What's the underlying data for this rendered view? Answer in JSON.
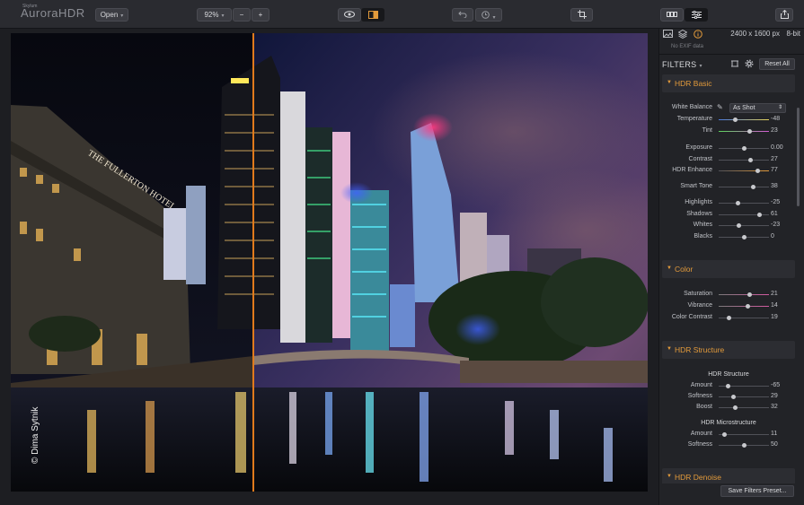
{
  "app": {
    "logo_small": "Skylum",
    "logo": "AuroraHDR"
  },
  "toolbar": {
    "open_label": "Open",
    "zoom_value": "92%",
    "zoom_out_label": "−",
    "zoom_in_label": "+"
  },
  "photo": {
    "credit": "© Dima Sytnik"
  },
  "info": {
    "size": "2400 x 1600 px",
    "bitdepth": "8-bit",
    "exif": "No EXIF data"
  },
  "filters": {
    "title": "FILTERS",
    "reset_label": "Reset All",
    "save_preset_label": "Save Filters Preset..."
  },
  "sections": {
    "basic": {
      "title": "HDR Basic",
      "white_balance_label": "White Balance",
      "white_balance_value": "As Shot",
      "rows": [
        {
          "label": "Temperature",
          "value": "-48",
          "pos": 0.33,
          "track": "wb"
        },
        {
          "label": "Tint",
          "value": "23",
          "pos": 0.6,
          "track": "tint"
        },
        {
          "label": "Exposure",
          "value": "0.00",
          "pos": 0.5
        },
        {
          "label": "Contrast",
          "value": "27",
          "pos": 0.62
        },
        {
          "label": "HDR Enhance",
          "value": "77",
          "pos": 0.77,
          "track": "warm"
        },
        {
          "label": "Smart Tone",
          "value": "38",
          "pos": 0.68
        },
        {
          "label": "Highlights",
          "value": "-25",
          "pos": 0.38
        },
        {
          "label": "Shadows",
          "value": "61",
          "pos": 0.8
        },
        {
          "label": "Whites",
          "value": "-23",
          "pos": 0.4
        },
        {
          "label": "Blacks",
          "value": "0",
          "pos": 0.5
        }
      ]
    },
    "color": {
      "title": "Color",
      "rows": [
        {
          "label": "Saturation",
          "value": "21",
          "pos": 0.6,
          "track": "color"
        },
        {
          "label": "Vibrance",
          "value": "14",
          "pos": 0.57,
          "track": "color"
        },
        {
          "label": "Color Contrast",
          "value": "19",
          "pos": 0.19
        }
      ]
    },
    "structure": {
      "title": "HDR Structure",
      "sub1": "HDR Structure",
      "sub2": "HDR Microstructure",
      "rows1": [
        {
          "label": "Amount",
          "value": "-65",
          "pos": 0.17
        },
        {
          "label": "Softness",
          "value": "29",
          "pos": 0.29
        },
        {
          "label": "Boost",
          "value": "32",
          "pos": 0.32
        }
      ],
      "rows2": [
        {
          "label": "Amount",
          "value": "11",
          "pos": 0.11
        },
        {
          "label": "Softness",
          "value": "50",
          "pos": 0.5
        }
      ]
    },
    "denoise": {
      "title": "HDR Denoise"
    }
  },
  "colors": {
    "accent": "#e29a3b",
    "split_line": "#e07a1c",
    "panel_bg": "#222327",
    "toolbar_bg": "#2a2b30"
  }
}
